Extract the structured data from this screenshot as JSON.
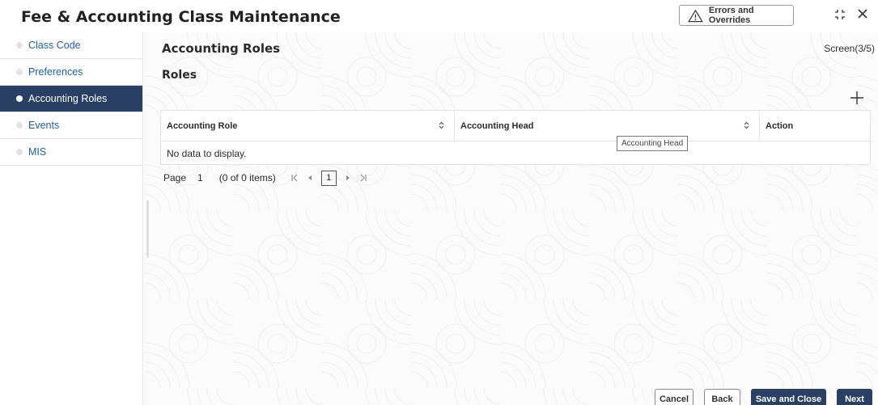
{
  "window": {
    "title": "Fee & Accounting Class Maintenance",
    "errors_button": "Errors and Overrides"
  },
  "sidebar": {
    "items": [
      {
        "label": "Class Code",
        "active": false
      },
      {
        "label": "Preferences",
        "active": false
      },
      {
        "label": "Accounting Roles",
        "active": true
      },
      {
        "label": "Events",
        "active": false
      },
      {
        "label": "MIS",
        "active": false
      }
    ]
  },
  "main": {
    "section_title": "Accounting Roles",
    "screen_count": "Screen(3/5)",
    "sub_title": "Roles",
    "grid": {
      "columns": [
        "Accounting Role",
        "Accounting Head",
        "Action"
      ],
      "empty_message": "No data to display.",
      "tooltip": "Accounting Head"
    },
    "pager": {
      "label": "Page",
      "page_number": "1",
      "items_text": "(0 of 0 items)",
      "current_page": "1"
    }
  },
  "footer": {
    "cancel": "Cancel",
    "back": "Back",
    "save_close": "Save and Close",
    "next": "Next"
  },
  "colors": {
    "accent": "#2a3f64",
    "link": "#1d5fa8"
  }
}
